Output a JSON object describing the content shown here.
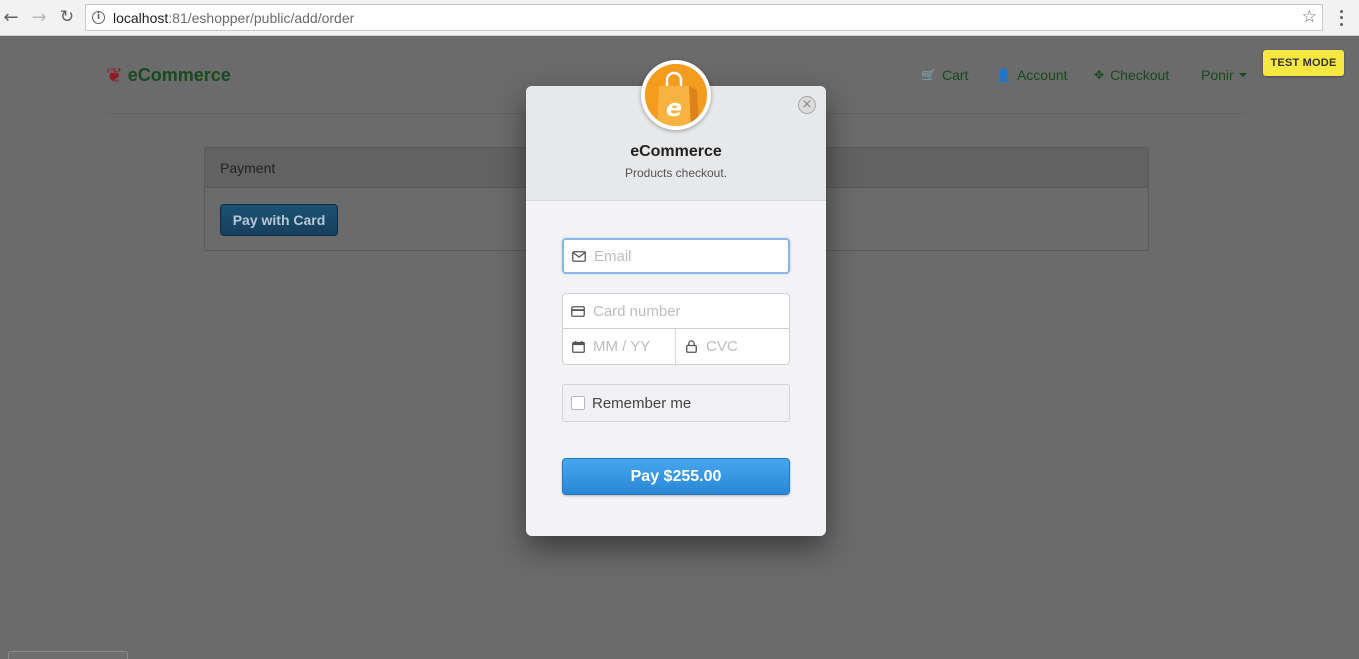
{
  "browser": {
    "url_host": "localhost",
    "url_rest": ":81/eshopper/public/add/order"
  },
  "site": {
    "brand": "eCommerce",
    "nav": {
      "cart": "Cart",
      "account": "Account",
      "checkout": "Checkout",
      "user": "Ponir"
    },
    "test_mode": "TEST MODE",
    "panel_title": "Payment",
    "pay_with_card": "Pay with Card"
  },
  "checkout": {
    "title": "eCommerce",
    "subtitle": "Products checkout.",
    "close_label": "×",
    "email_placeholder": "Email",
    "card_placeholder": "Card number",
    "exp_placeholder": "MM / YY",
    "cvc_placeholder": "CVC",
    "remember_label": "Remember me",
    "pay_label": "Pay $255.00"
  },
  "colors": {
    "overlay": "#6b6b6b",
    "pay_button": "#2f8fdc",
    "test_badge": "#f6e742",
    "merchant_logo": "#f39c1e"
  },
  "icons": [
    "back-arrow-icon",
    "forward-arrow-icon",
    "reload-icon",
    "info-icon",
    "star-icon",
    "more-vert-icon",
    "leaf-logo-icon",
    "cart-icon",
    "user-icon",
    "crosshair-icon",
    "close-icon",
    "shopping-bag-icon",
    "mail-icon",
    "card-icon",
    "calendar-icon",
    "lock-icon"
  ]
}
